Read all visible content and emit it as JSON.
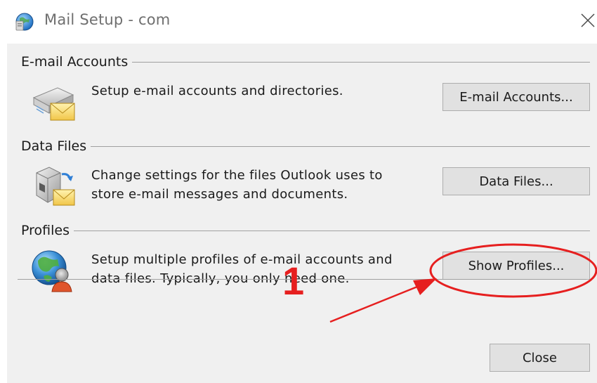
{
  "window": {
    "title": "Mail Setup - com",
    "close_glyph": "✕"
  },
  "sections": {
    "email_accounts": {
      "title": "E-mail Accounts",
      "description": "Setup e-mail accounts and directories.",
      "button": "E-mail Accounts..."
    },
    "data_files": {
      "title": "Data Files",
      "description_line1": "Change settings for the files Outlook uses to",
      "description_line2": "store e-mail messages and documents.",
      "button": "Data Files..."
    },
    "profiles": {
      "title": "Profiles",
      "description_line1": "Setup multiple profiles of e-mail accounts and",
      "description_line2": "data files. Typically, you only need one.",
      "button": "Show Profiles..."
    }
  },
  "footer": {
    "close_button": "Close"
  },
  "annotation": {
    "step_number": "1",
    "color": "#e61f1f"
  },
  "icons": {
    "app": "mail-setup-icon",
    "email_accounts": "email-envelope-icon",
    "data_files": "data-file-mail-icon",
    "profiles": "globe-user-icon"
  }
}
